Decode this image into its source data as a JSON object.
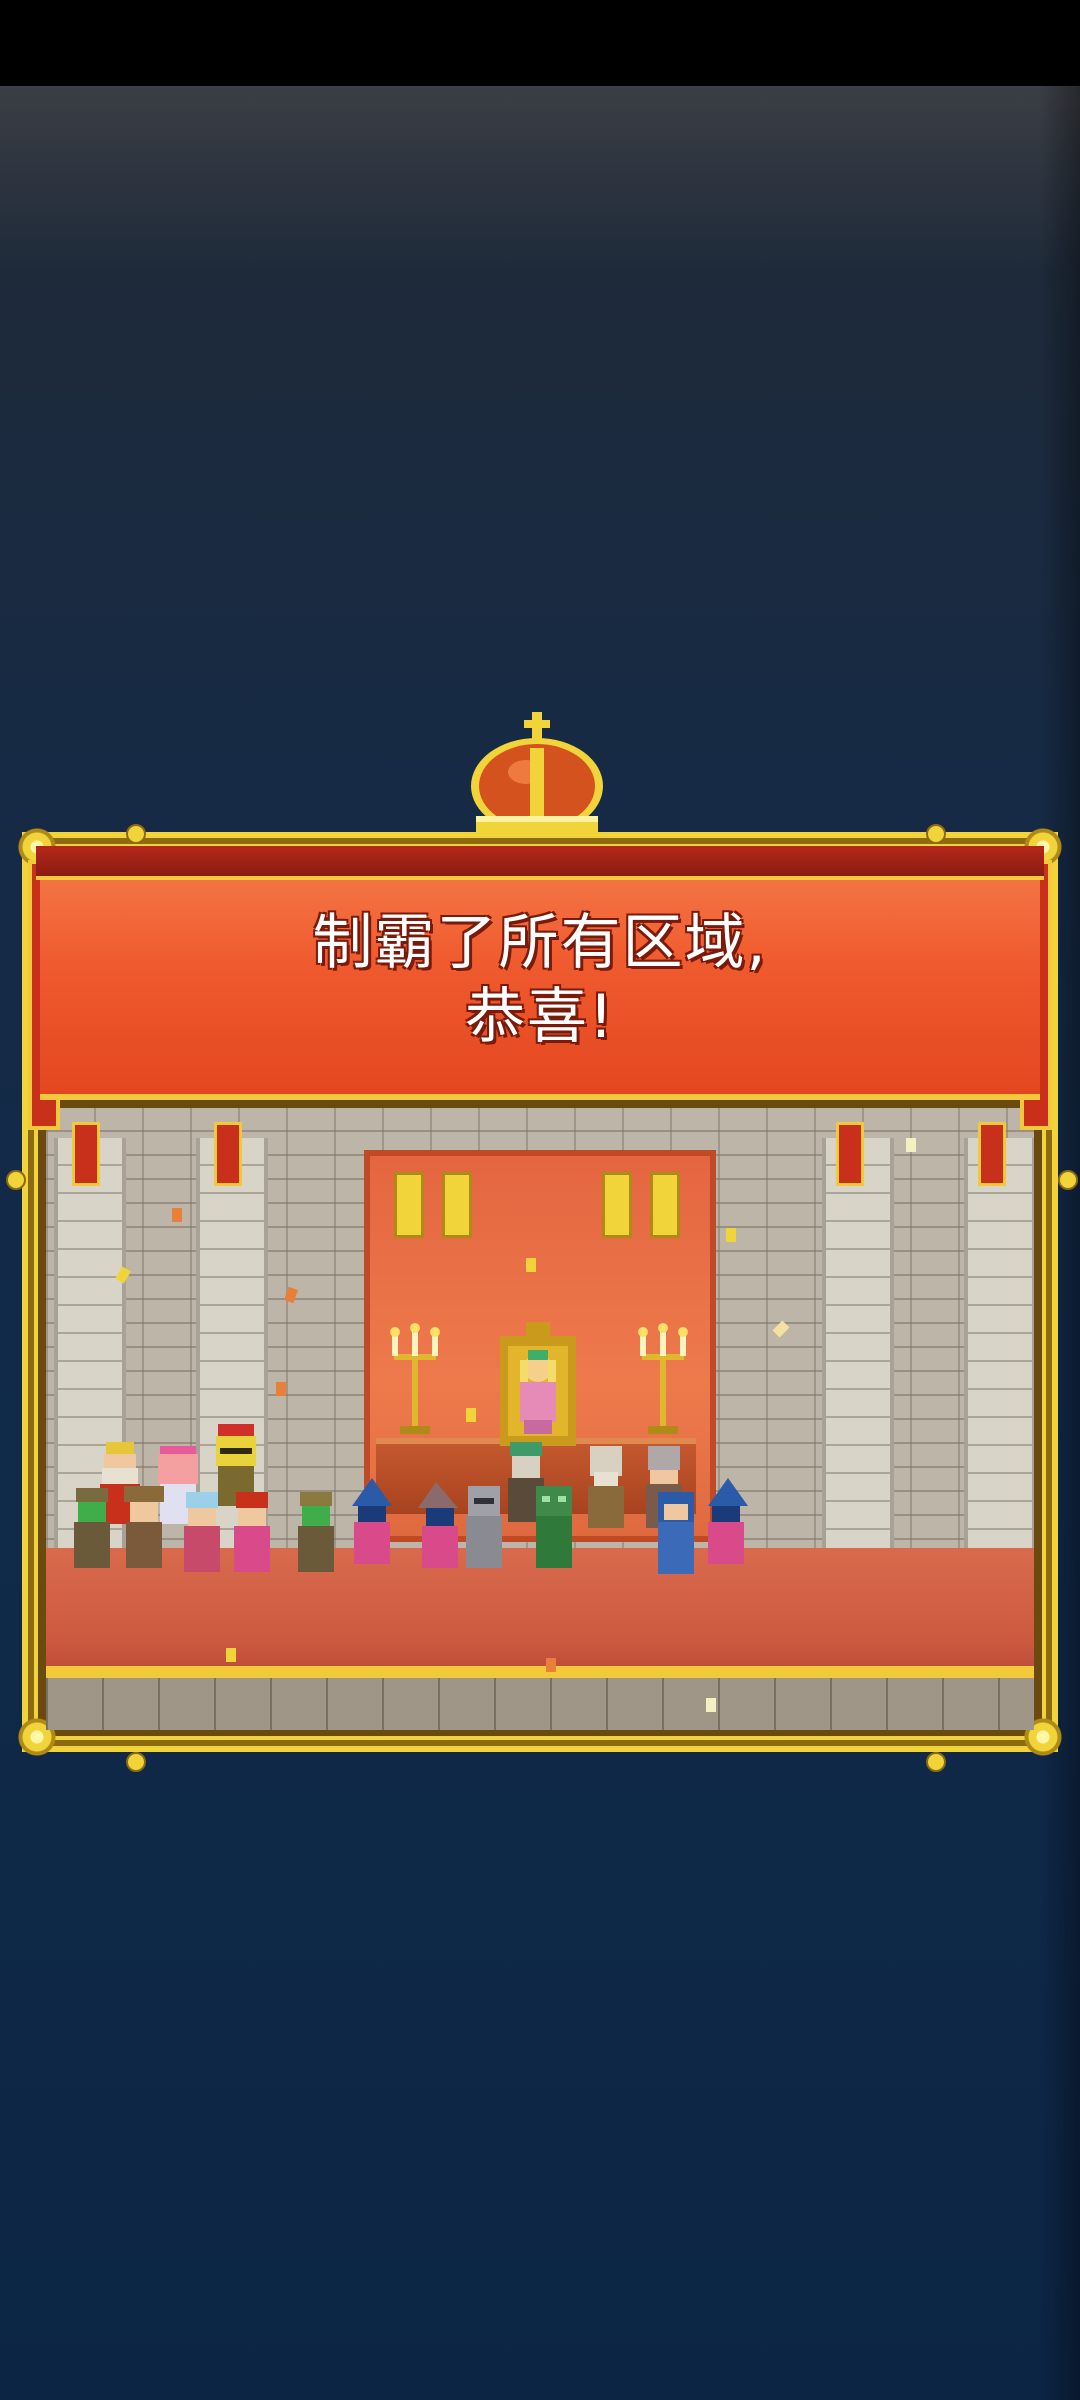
{
  "game": {
    "message_line1": "制霸了所有区域,",
    "message_line2": "恭喜!"
  },
  "icons": {
    "crown": "crown-icon",
    "throne": "throne-icon"
  },
  "colors": {
    "banner": "#ef5a2e",
    "frame_gold": "#f1d43a",
    "background": "#102a4a"
  }
}
